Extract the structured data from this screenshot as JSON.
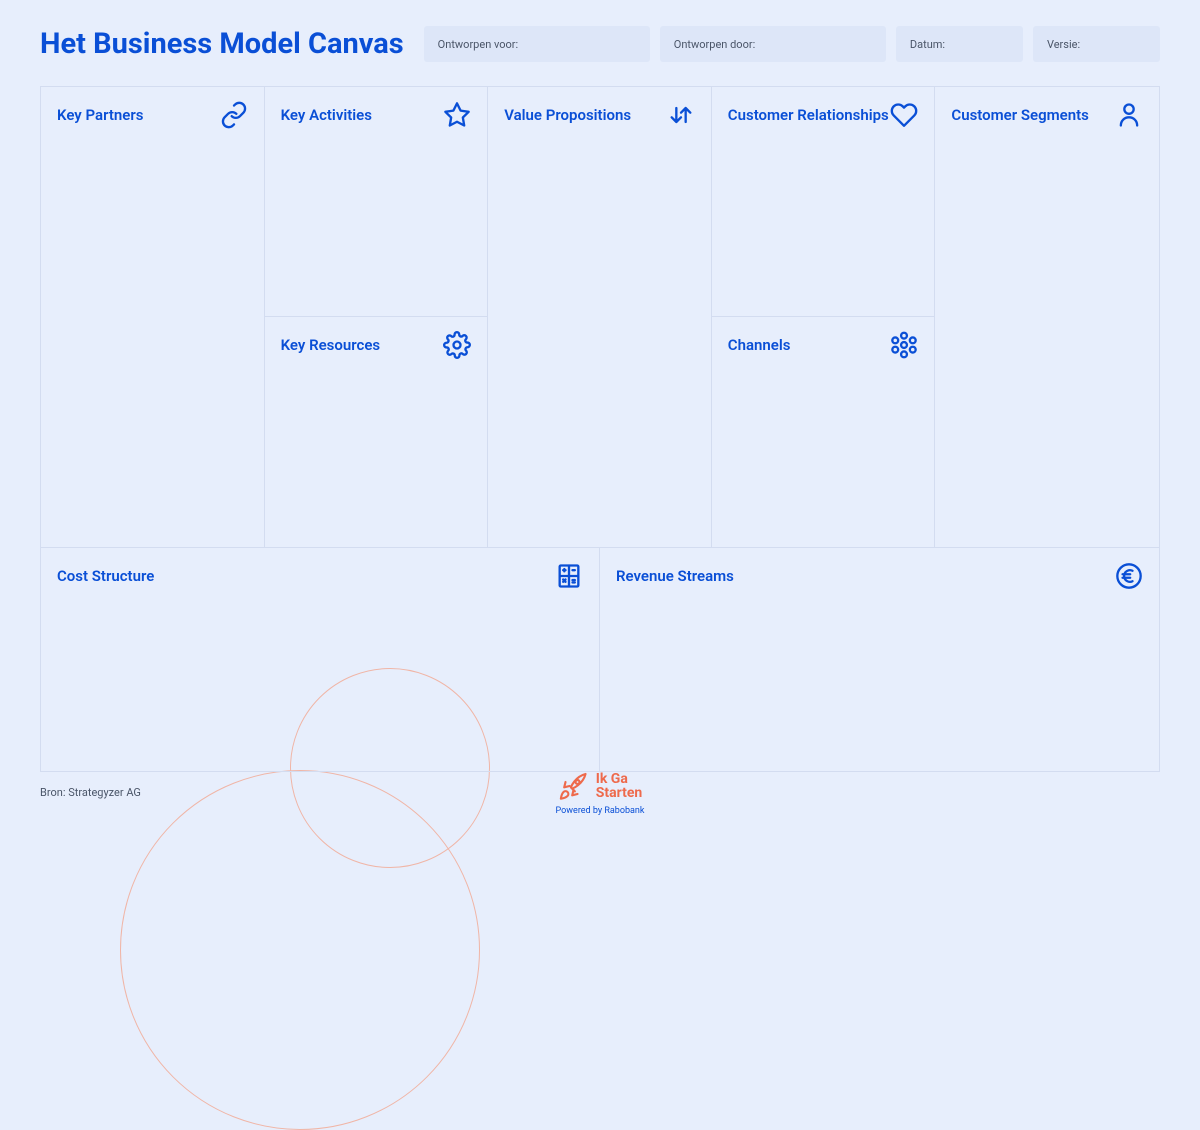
{
  "title": "Het Business Model Canvas",
  "meta": {
    "designed_for_label": "Ontworpen voor:",
    "designed_by_label": "Ontworpen door:",
    "date_label": "Datum:",
    "version_label": "Versie:"
  },
  "blocks": {
    "key_partners": "Key Partners",
    "key_activities": "Key Activities",
    "key_resources": "Key Resources",
    "value_propositions": "Value Propositions",
    "customer_relationships": "Customer Relationships",
    "channels": "Channels",
    "customer_segments": "Customer Segments",
    "cost_structure": "Cost Structure",
    "revenue_streams": "Revenue Streams"
  },
  "footer": {
    "source": "Bron: Strategyzer AG",
    "brand_line1": "Ik Ga",
    "brand_line2": "Starten",
    "brand_sub": "Powered by Rabobank"
  }
}
